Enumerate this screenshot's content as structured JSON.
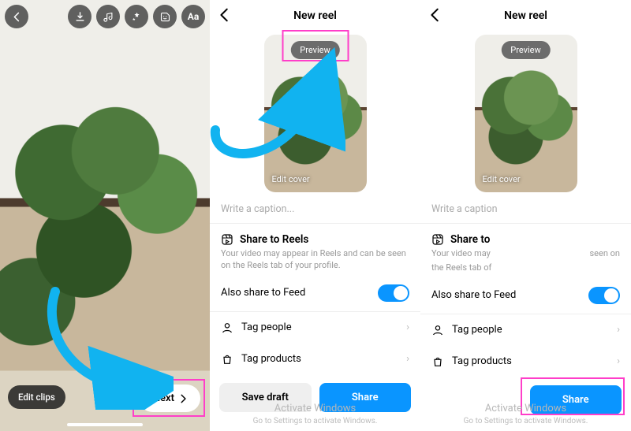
{
  "screen1": {
    "edit_clips_label": "Edit clips",
    "next_label": "Next",
    "icons": [
      "back",
      "download",
      "music",
      "effects",
      "sticker",
      "text"
    ]
  },
  "screen2": {
    "title": "New reel",
    "preview_label": "Preview",
    "edit_cover_label": "Edit cover",
    "caption_placeholder": "Write a caption...",
    "share_section_title": "Share to Reels",
    "share_section_desc": "Your video may appear in Reels and can be seen on the Reels tab of your profile.",
    "also_share_label": "Also share to Feed",
    "also_share_on": true,
    "tag_people_label": "Tag people",
    "tag_products_label": "Tag products",
    "save_draft_label": "Save draft",
    "share_button_label": "Share"
  },
  "screen3": {
    "title": "New reel",
    "preview_label": "Preview",
    "edit_cover_label": "Edit cover",
    "caption_placeholder": "Write a caption",
    "share_section_title": "Share to",
    "share_section_desc_left": "Your video may",
    "share_section_desc_right": "seen on",
    "share_section_desc_line2": "the Reels tab of",
    "also_share_label": "Also share to Feed",
    "also_share_on": true,
    "tag_people_label": "Tag people",
    "tag_products_label": "Tag products",
    "share_button_label": "Share"
  },
  "watermark": {
    "line1": "Activate Windows",
    "line2": "Go to Settings to activate Windows."
  },
  "colors": {
    "accent": "#0a95ff",
    "highlight": "#ff3ec9",
    "arrow": "#11b3f0"
  }
}
